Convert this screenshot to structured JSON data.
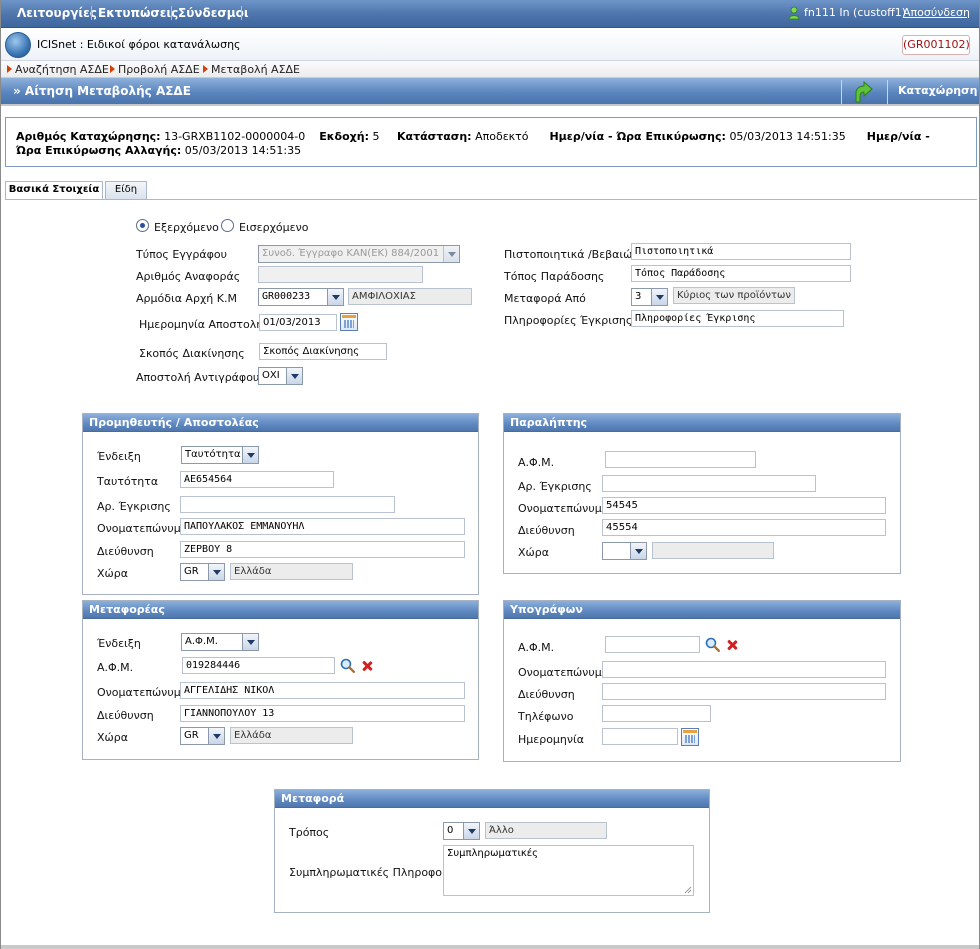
{
  "topbar": {
    "menu": [
      "Λειτουργίες",
      "Εκτυπώσεις",
      "Σύνδεσμοι"
    ],
    "user": "fn111 In (custoff1)",
    "logout": "Αποσύνδεση"
  },
  "app": {
    "title": "ICISnet : Ειδικοί φόροι κατανάλωσης",
    "office": "(GR001102)"
  },
  "breadcrumbs": [
    "Αναζήτηση ΑΣΔΕ",
    "Προβολή ΑΣΔΕ",
    "Μεταβολή ΑΣΔΕ"
  ],
  "page": {
    "title": "» Αίτηση Μεταβολής ΑΣΔΕ",
    "save_label": "Καταχώρηση"
  },
  "info": {
    "reg_label": "Αριθμός Καταχώρησης:",
    "reg_value": "13-GRXB1102-0000004-0",
    "version_label": "Εκδοχή:",
    "version_value": "5",
    "status_label": "Κατάσταση:",
    "status_value": "Αποδεκτό",
    "validation_label": "Ημερ/νία - Ώρα Επικύρωσης:",
    "validation_value": "05/03/2013 14:51:35",
    "change_label_1": "Ημερ/νία -",
    "change_label_2": "Ώρα Επικύρωσης Αλλαγής:",
    "change_value": "05/03/2013 14:51:35"
  },
  "tabs": [
    "Βασικά Στοιχεία",
    "Είδη"
  ],
  "direction": {
    "outgoing": "Εξερχόμενο",
    "incoming": "Εισερχόμενο",
    "selected": "outgoing"
  },
  "general": {
    "doc_type_label": "Τύπος Εγγράφου",
    "doc_type_value": "Συνοδ. Έγγραφο ΚΑΝ(ΕΚ) 884/2001",
    "ref_no_label": "Αριθμός Αναφοράς",
    "ref_no_value": "",
    "authority_label": "Αρμόδια Αρχή Κ.Μ",
    "authority_code": "GR000233",
    "authority_name": "ΑΜΦΙΛΟΧΙΑΣ",
    "send_date_label": "Ημερομηνία Αποστολής",
    "send_date_value": "01/03/2013",
    "purpose_label": "Σκοπός Διακίνησης",
    "purpose_value": "Σκοπός Διακίνησης",
    "copy_label": "Αποστολή Αντιγράφου",
    "copy_value": "ΟΧΙ",
    "cert_label": "Πιστοποιητικά /Βεβαιώσεις",
    "cert_value": "Πιστοποιητικά",
    "delivery_label": "Τόπος Παράδοσης",
    "delivery_value": "Τόπος Παράδοσης",
    "transport_from_label": "Μεταφορά Από",
    "transport_from_code": "3",
    "transport_from_name": "Κύριος των προϊόντων",
    "approval_info_label": "Πληροφορίες Έγκρισης",
    "approval_info_value": "Πληροφορίες Έγκρισης"
  },
  "supplier": {
    "title": "Προμηθευτής / Αποστολέας",
    "indication_label": "Ένδειξη",
    "indication_value": "Ταυτότητα",
    "id_label": "Ταυτότητα",
    "id_value": "ΑΕ654564",
    "approval_label": "Αρ. Έγκρισης",
    "approval_value": "",
    "name_label": "Ονοματεπώνυμο",
    "name_value": "ΠΑΠΟΥΛΑΚΟΣ ΕΜΜΑΝΟΥΗΛ",
    "address_label": "Διεύθυνση",
    "address_value": "ΖΕΡΒΟΥ 8",
    "country_label": "Χώρα",
    "country_code": "GR",
    "country_name": "Ελλάδα"
  },
  "receiver": {
    "title": "Παραλήπτης",
    "afm_label": "Α.Φ.Μ.",
    "afm_value": "",
    "approval_label": "Αρ. Έγκρισης",
    "approval_value": "",
    "name_label": "Ονοματεπώνυμο",
    "name_value": "54545",
    "address_label": "Διεύθυνση",
    "address_value": "45554",
    "country_label": "Χώρα",
    "country_code": "",
    "country_name": ""
  },
  "carrier": {
    "title": "Μεταφορέας",
    "indication_label": "Ένδειξη",
    "indication_value": "Α.Φ.Μ.",
    "afm_label": "Α.Φ.Μ.",
    "afm_value": "019284446",
    "name_label": "Ονοματεπώνυμο",
    "name_value": "ΑΓΓΕΛΙΔΗΣ ΝΙΚΟΛ",
    "address_label": "Διεύθυνση",
    "address_value": "ΓΙΑΝΝΟΠΟΥΛΟΥ 13",
    "country_label": "Χώρα",
    "country_code": "GR",
    "country_name": "Ελλάδα"
  },
  "signer": {
    "title": "Υπογράφων",
    "afm_label": "Α.Φ.Μ.",
    "afm_value": "",
    "name_label": "Ονοματεπώνυμο",
    "name_value": "",
    "address_label": "Διεύθυνση",
    "address_value": "",
    "phone_label": "Τηλέφωνο",
    "phone_value": "",
    "date_label": "Ημερομηνία",
    "date_value": ""
  },
  "transport": {
    "title": "Μεταφορά",
    "mode_label": "Τρόπος",
    "mode_code": "0",
    "mode_name": "Άλλο",
    "extra_label": "Συμπληρωματικές Πληροφορίες",
    "extra_value": "Συμπληρωματικές"
  }
}
